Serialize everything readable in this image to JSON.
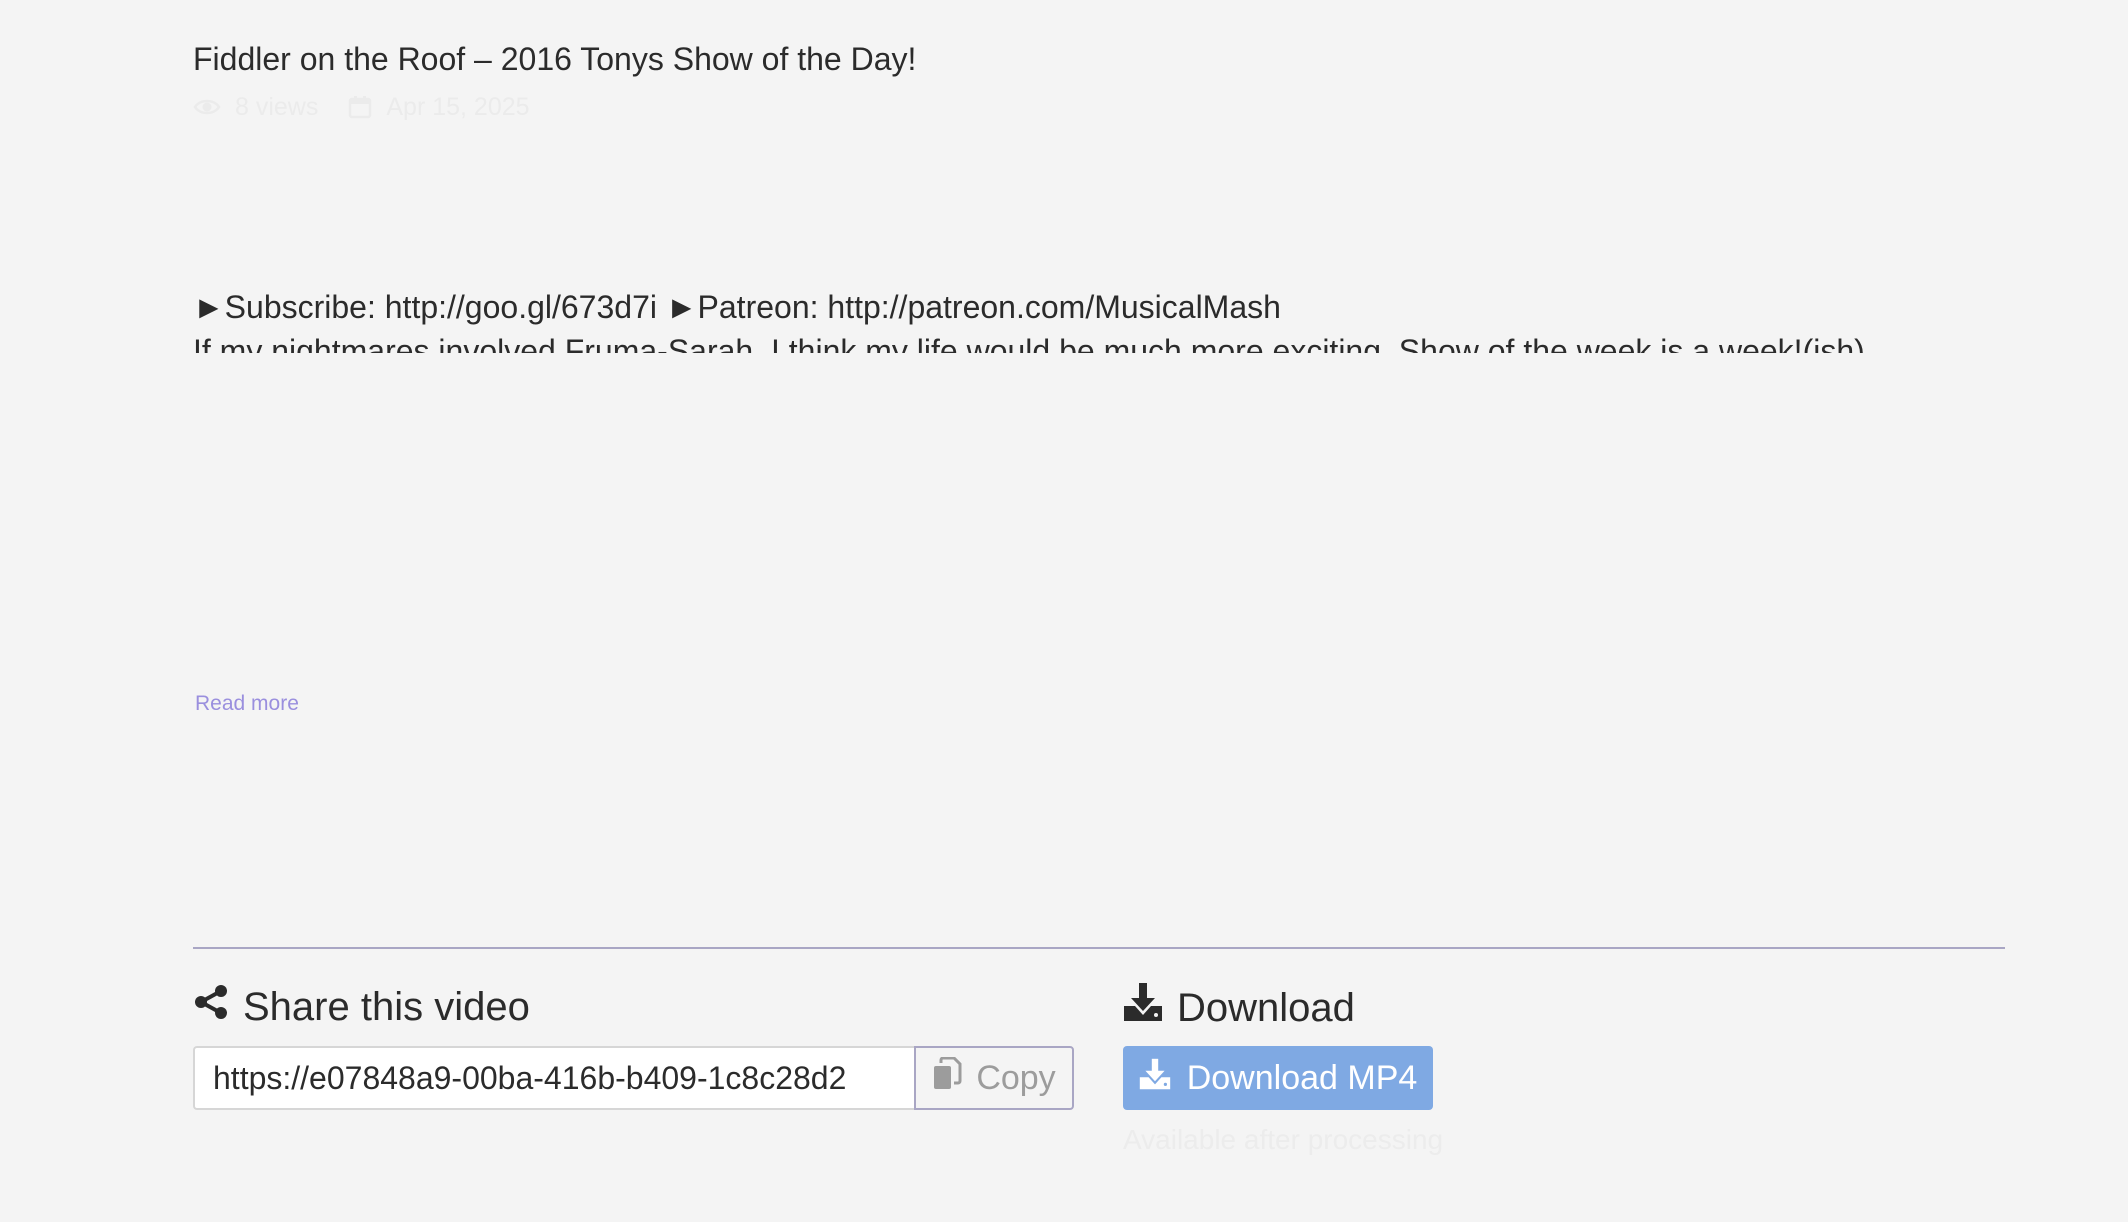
{
  "video": {
    "title": "Fiddler on the Roof – 2016 Tonys Show of the Day!",
    "views": "8 views",
    "date": "Apr 15, 2025"
  },
  "description": {
    "line1": "►Subscribe: http://goo.gl/673d7i ►Patreon: http://patreon.com/MusicalMash",
    "line2": "If my nightmares involved Fruma-Sarah, I think my life would be much more exciting. Show of the week is a week!(ish)"
  },
  "read_more_label": "Read more",
  "share": {
    "heading": "Share this video",
    "url": "https://e07848a9-00ba-416b-b409-1c8c28d2",
    "copy_label": "Copy"
  },
  "download": {
    "heading": "Download",
    "button_label": "Download MP4",
    "note": "Available after processing"
  },
  "colors": {
    "background": "#f4f4f4",
    "accent_link": "#9a8fde",
    "download_button": "#7fa9e3",
    "divider": "#a9a6c4"
  }
}
